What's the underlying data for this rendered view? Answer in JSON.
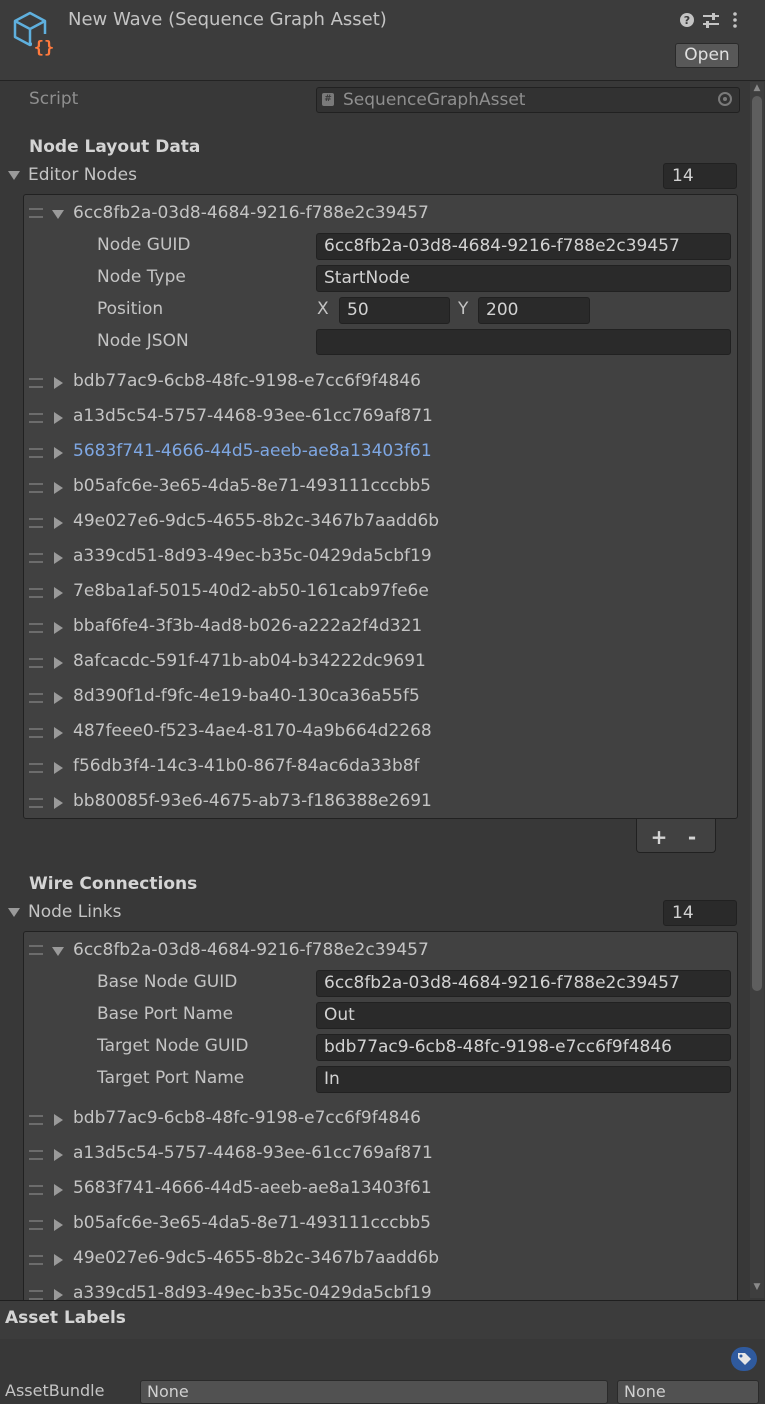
{
  "header": {
    "title": "New Wave (Sequence Graph Asset)",
    "open_label": "Open",
    "icons": [
      "help-icon",
      "preset-sliders-icon",
      "kebab-menu-icon"
    ]
  },
  "script_field": {
    "label": "Script",
    "value": "SequenceGraphAsset",
    "icon": "script-icon"
  },
  "node_layout": {
    "header": "Node Layout Data",
    "list_label": "Editor Nodes",
    "count": "14",
    "expanded": {
      "guid": "6cc8fb2a-03d8-4684-9216-f788e2c39457",
      "fields": {
        "node_guid_label": "Node GUID",
        "node_guid_value": "6cc8fb2a-03d8-4684-9216-f788e2c39457",
        "node_type_label": "Node Type",
        "node_type_value": "StartNode",
        "position_label": "Position",
        "x_label": "X",
        "x_value": "50",
        "y_label": "Y",
        "y_value": "200",
        "node_json_label": "Node JSON",
        "node_json_value": ""
      }
    },
    "items": [
      "bdb77ac9-6cb8-48fc-9198-e7cc6f9f4846",
      "a13d5c54-5757-4468-93ee-61cc769af871",
      "5683f741-4666-44d5-aeeb-ae8a13403f61",
      "b05afc6e-3e65-4da5-8e71-493111cccbb5",
      "49e027e6-9dc5-4655-8b2c-3467b7aadd6b",
      "a339cd51-8d93-49ec-b35c-0429da5cbf19",
      "7e8ba1af-5015-40d2-ab50-161cab97fe6e",
      "bbaf6fe4-3f3b-4ad8-b026-a222a2f4d321",
      "8afcacdc-591f-471b-ab04-b34222dc9691",
      "8d390f1d-f9fc-4e19-ba40-130ca36a55f5",
      "487feee0-f523-4ae4-8170-4a9b664d2268",
      "f56db3f4-14c3-41b0-867f-84ac6da33b8f",
      "bb80085f-93e6-4675-ab73-f186388e2691"
    ],
    "selected_index": 2,
    "add_label": "+",
    "remove_label": "-"
  },
  "wire_connections": {
    "header": "Wire Connections",
    "list_label": "Node Links",
    "count": "14",
    "expanded": {
      "guid": "6cc8fb2a-03d8-4684-9216-f788e2c39457",
      "fields": {
        "base_node_guid_label": "Base Node GUID",
        "base_node_guid_value": "6cc8fb2a-03d8-4684-9216-f788e2c39457",
        "base_port_name_label": "Base Port Name",
        "base_port_name_value": "Out",
        "target_node_guid_label": "Target Node GUID",
        "target_node_guid_value": "bdb77ac9-6cb8-48fc-9198-e7cc6f9f4846",
        "target_port_name_label": "Target Port Name",
        "target_port_name_value": "In"
      }
    },
    "items": [
      "bdb77ac9-6cb8-48fc-9198-e7cc6f9f4846",
      "a13d5c54-5757-4468-93ee-61cc769af871",
      "5683f741-4666-44d5-aeeb-ae8a13403f61",
      "b05afc6e-3e65-4da5-8e71-493111cccbb5",
      "49e027e6-9dc5-4655-8b2c-3467b7aadd6b",
      "a339cd51-8d93-49ec-b35c-0429da5cbf19"
    ]
  },
  "asset_labels": {
    "title": "Asset Labels",
    "asset_bundle_label": "AssetBundle",
    "asset_bundle_value": "None",
    "variant_value": "None"
  },
  "colors": {
    "background": "#383838",
    "field": "#2a2a2a",
    "selected_text": "#7ea7e3",
    "tag_icon": "#2f5a9e"
  }
}
